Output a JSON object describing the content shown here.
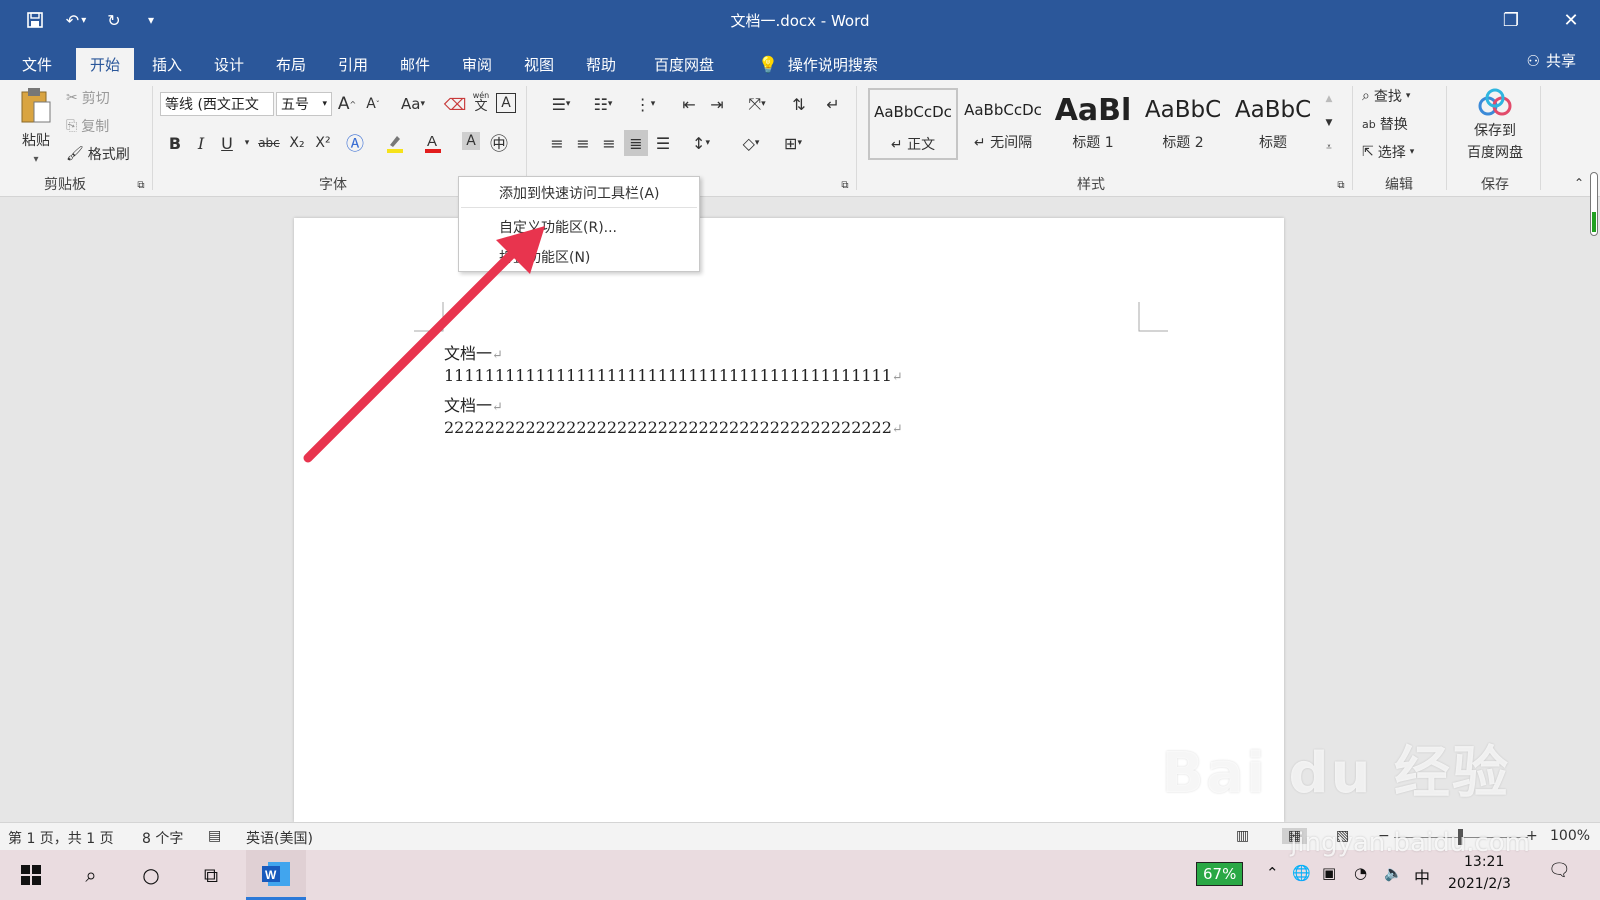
{
  "window": {
    "title": "文档一.docx  -  Word"
  },
  "tabs": [
    {
      "label": "文件"
    },
    {
      "label": "开始"
    },
    {
      "label": "插入"
    },
    {
      "label": "设计"
    },
    {
      "label": "布局"
    },
    {
      "label": "引用"
    },
    {
      "label": "邮件"
    },
    {
      "label": "审阅"
    },
    {
      "label": "视图"
    },
    {
      "label": "帮助"
    },
    {
      "label": "百度网盘"
    }
  ],
  "tell_me": "操作说明搜索",
  "share": "共享",
  "clipboard": {
    "paste": "粘贴",
    "cut": "剪切",
    "copy": "复制",
    "format_painter": "格式刷",
    "group_label": "剪贴板"
  },
  "font": {
    "font_name": "等线 (西文正文",
    "font_size": "五号",
    "group_label": "字体",
    "bold": "B",
    "italic": "I",
    "underline": "U",
    "strike": "abc",
    "subscript": "X₂",
    "superscript": "X²",
    "change_case": "Aa",
    "grow": "A",
    "shrink": "A",
    "phonetic": "文",
    "phonetic_top": "wén",
    "border": "A",
    "font_color_label": "A",
    "shading": "A"
  },
  "styles": {
    "group_label": "样式",
    "items": [
      {
        "sample": "AaBbCcDc",
        "name": "正文"
      },
      {
        "sample": "AaBbCcDc",
        "name": "无间隔"
      },
      {
        "sample": "AaBl",
        "name": "标题 1"
      },
      {
        "sample": "AaBbC",
        "name": "标题 2"
      },
      {
        "sample": "AaBbC",
        "name": "标题"
      }
    ]
  },
  "editing": {
    "find": "查找",
    "replace": "替换",
    "select": "选择",
    "group_label": "编辑"
  },
  "save": {
    "save_to": "保存到",
    "baidu": "百度网盘",
    "group_label": "保存"
  },
  "context_menu": {
    "items": [
      {
        "label": "添加到快速访问工具栏(A)"
      },
      {
        "label": "自定义功能区(R)..."
      },
      {
        "label": "折叠功能区(N)"
      }
    ]
  },
  "document": {
    "lines": [
      "文档一",
      "11111111111111111111111111111111111111111111",
      "文档一",
      "22222222222222222222222222222222222222222222"
    ],
    "pilcrow": "↵"
  },
  "status": {
    "page": "第 1 页，共 1 页",
    "words": "8 个字",
    "language": "英语(美国)",
    "zoom": "100%"
  },
  "taskbar": {
    "battery": "67%",
    "ime": "中",
    "time": "13:21",
    "date": "2021/2/3"
  },
  "watermark": {
    "brand": "Bai du 经验",
    "url": "jingyan.baidu.com"
  },
  "colors": {
    "title_bar": "#2b579a",
    "arrow": "#e8344e"
  }
}
